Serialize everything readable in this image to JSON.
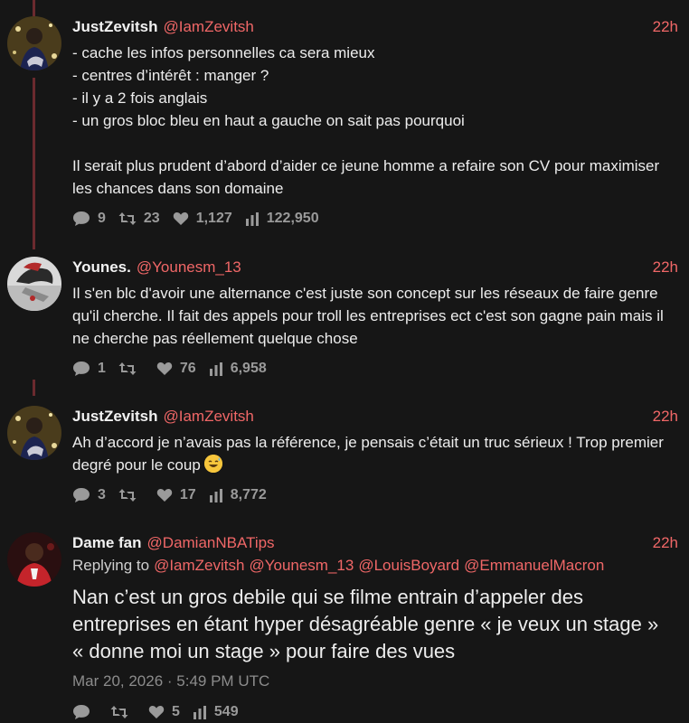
{
  "tweets": [
    {
      "name": "JustZevitsh",
      "handle": "@IamZevitsh",
      "time": "22h",
      "text": "- cache les infos personnelles ca sera mieux\n- centres d’intérêt : manger ?\n- il y a 2 fois anglais\n- un gros bloc bleu en haut a gauche on sait pas pourquoi\n\nIl serait plus prudent d’abord d’aider ce jeune homme a refaire son CV pour maximiser les chances dans son domaine",
      "replies": "9",
      "retweets": "23",
      "likes": "1,127",
      "views": "122,950"
    },
    {
      "name": "Younes.",
      "handle": "@Younesm_13",
      "time": "22h",
      "text": "Il s'en blc d'avoir une alternance c'est juste son concept sur les réseaux de faire genre qu'il cherche. Il fait des appels pour troll les entreprises ect c'est son gagne pain mais il ne cherche pas réellement quelque chose",
      "replies": "1",
      "retweets": "",
      "likes": "76",
      "views": "6,958"
    },
    {
      "name": "JustZevitsh",
      "handle": "@IamZevitsh",
      "time": "22h",
      "text": "Ah d’accord je n’avais pas la référence, je pensais c’était un truc sérieux ! Trop premier degré pour le coup",
      "emoji": "sweat-smile-emoji",
      "replies": "3",
      "retweets": "",
      "likes": "17",
      "views": "8,772"
    },
    {
      "name": "Dame fan",
      "handle": "@DamianNBATips",
      "time": "22h",
      "replying_label": "Replying to",
      "replying_to": [
        "@IamZevitsh",
        "@Younesm_13",
        "@LouisBoyard",
        "@EmmanuelMacron"
      ],
      "text": "Nan c’est un gros debile qui se filme entrain d’appeler des entreprises en étant hyper désagréable genre « je veux un stage » « donne moi un stage » pour faire des vues",
      "datetime": "Mar 20, 2026 · 5:49 PM UTC",
      "replies": "",
      "retweets": "",
      "likes": "5",
      "views": "549"
    }
  ],
  "colors": {
    "background": "#161616",
    "accent": "#f06767",
    "thread_line": "#6b2a2e",
    "muted": "#9a9a9a"
  },
  "icons": {
    "reply": "comment-bubble-icon",
    "retweet": "retweet-icon",
    "like": "heart-icon",
    "views": "bar-chart-icon"
  }
}
